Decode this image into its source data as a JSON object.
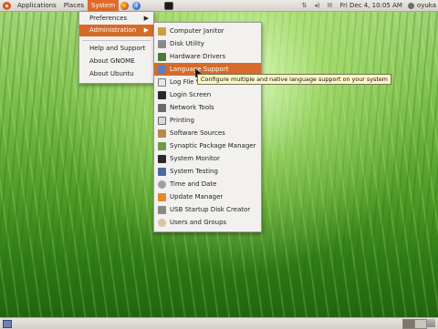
{
  "top_panel": {
    "menus": [
      "Applications",
      "Places",
      "System"
    ],
    "clock": "Fri Dec  4, 10:05 AM",
    "user": "oyuka",
    "icons": [
      "firefox-icon",
      "help-icon",
      "terminal-icon",
      "network-icon",
      "volume-icon",
      "mail-icon"
    ]
  },
  "system_menu": {
    "items": [
      {
        "label": "Preferences",
        "submenu": true
      },
      {
        "label": "Administration",
        "submenu": true,
        "highlighted": true
      },
      {
        "label": "Help and Support"
      },
      {
        "label": "About GNOME"
      },
      {
        "label": "About Ubuntu"
      }
    ]
  },
  "admin_menu": {
    "items": [
      {
        "label": "Computer Janitor",
        "icon": "broom-icon"
      },
      {
        "label": "Disk Utility",
        "icon": "disk-icon"
      },
      {
        "label": "Hardware Drivers",
        "icon": "chip-icon"
      },
      {
        "label": "Language Support",
        "icon": "language-icon",
        "highlighted": true
      },
      {
        "label": "Log File Vi",
        "icon": "magnifier-icon"
      },
      {
        "label": "Login Screen",
        "icon": "monitor-icon"
      },
      {
        "label": "Network Tools",
        "icon": "network-icon"
      },
      {
        "label": "Printing",
        "icon": "printer-icon"
      },
      {
        "label": "Software Sources",
        "icon": "package-icon"
      },
      {
        "label": "Synaptic Package Manager",
        "icon": "synaptic-icon"
      },
      {
        "label": "System Monitor",
        "icon": "monitor-icon"
      },
      {
        "label": "System Testing",
        "icon": "checklist-icon"
      },
      {
        "label": "Time and Date",
        "icon": "clock-icon"
      },
      {
        "label": "Update Manager",
        "icon": "update-icon"
      },
      {
        "label": "USB Startup Disk Creator",
        "icon": "usb-icon"
      },
      {
        "label": "Users and Groups",
        "icon": "users-icon"
      }
    ]
  },
  "tooltip": "Configure multiple and native language support on your system",
  "colors": {
    "highlight": "#d66a2a",
    "panel": "#e3e0db"
  }
}
